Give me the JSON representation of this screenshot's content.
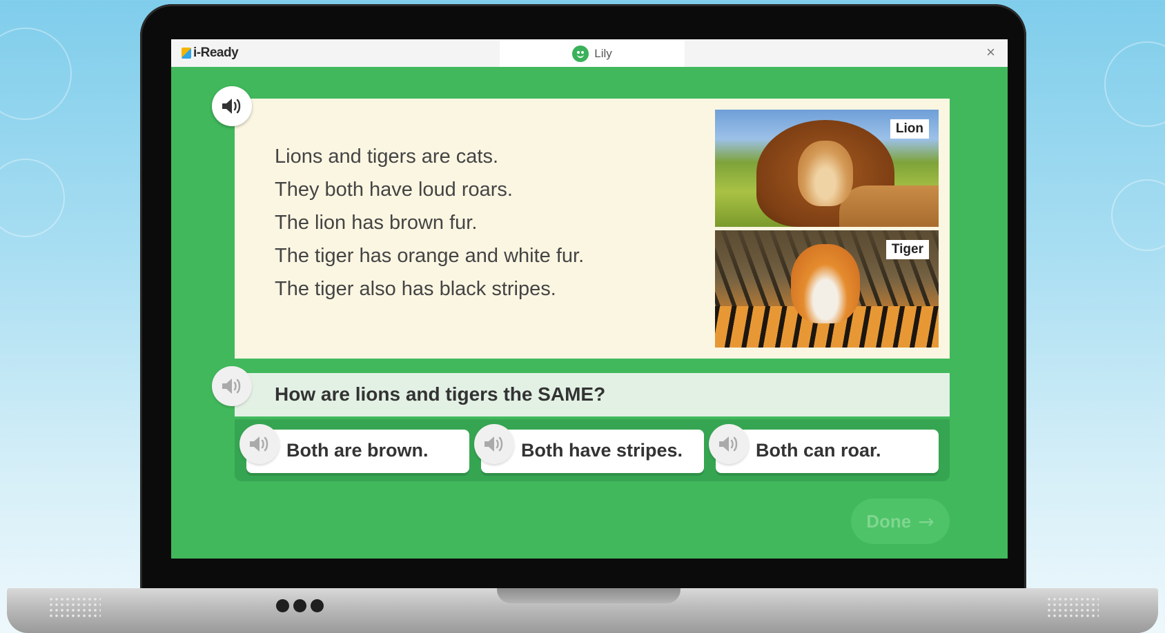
{
  "app": {
    "logo_text": "i-Ready",
    "user_name": "Lily",
    "close_symbol": "×"
  },
  "passage": {
    "lines": [
      "Lions and tigers are cats.",
      "They both have loud roars.",
      "The lion has brown fur.",
      "The tiger has orange and white fur.",
      "The tiger also has black stripes."
    ],
    "images": [
      {
        "label": "Lion",
        "icon": "lion-photo"
      },
      {
        "label": "Tiger",
        "icon": "tiger-photo"
      }
    ]
  },
  "question": {
    "text": "How are lions and tigers the SAME?"
  },
  "answers": [
    {
      "text": "Both are brown."
    },
    {
      "text": "Both have stripes."
    },
    {
      "text": "Both can roar."
    }
  ],
  "done": {
    "label": "Done",
    "arrow": "→"
  },
  "colors": {
    "screen_green": "#41b85c",
    "passage_bg": "#fbf6e2",
    "question_bg": "#e3f1e5"
  },
  "icons": {
    "audio": "speaker-icon",
    "avatar": "smiley-avatar-icon",
    "close": "close-icon"
  }
}
